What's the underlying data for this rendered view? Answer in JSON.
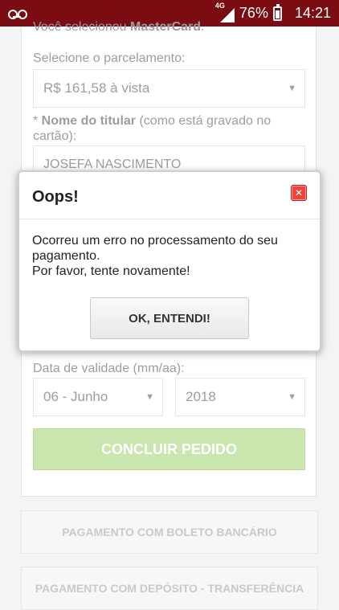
{
  "status_bar": {
    "network_label": "4G",
    "battery_percent": "76%",
    "battery_level": 0.76,
    "time": "14:21"
  },
  "page": {
    "selected_card_text_prefix": "Você selecionou ",
    "selected_card_name": "MasterCard",
    "selected_card_text_suffix": ".",
    "installments_label": "Selecione o parcelamento:",
    "installments_value": "R$ 161,58 à vista",
    "holder_label_required": "* ",
    "holder_label_bold": "Nome do titular",
    "holder_label_hint": " (como está gravado no cartão):",
    "holder_value": "JOSEFA NASCIMENTO",
    "expiry_label": "Data de validade (mm/aa):",
    "expiry_month_value": "06 - Junho",
    "expiry_year_value": "2018",
    "finish_button": "CONCLUIR PEDIDO",
    "boleto_button": "PAGAMENTO COM BOLETO BANCÁRIO",
    "deposit_button": "PAGAMENTO COM DEPÓSITO - TRANSFERÊNCIA"
  },
  "modal": {
    "title": "Oops!",
    "close_glyph": "✕",
    "message_line1": "Ocorreu um erro no processamento do seu pagamento.",
    "message_line2": "Por favor, tente novamente!",
    "ok_button": "OK, ENTENDI!"
  }
}
